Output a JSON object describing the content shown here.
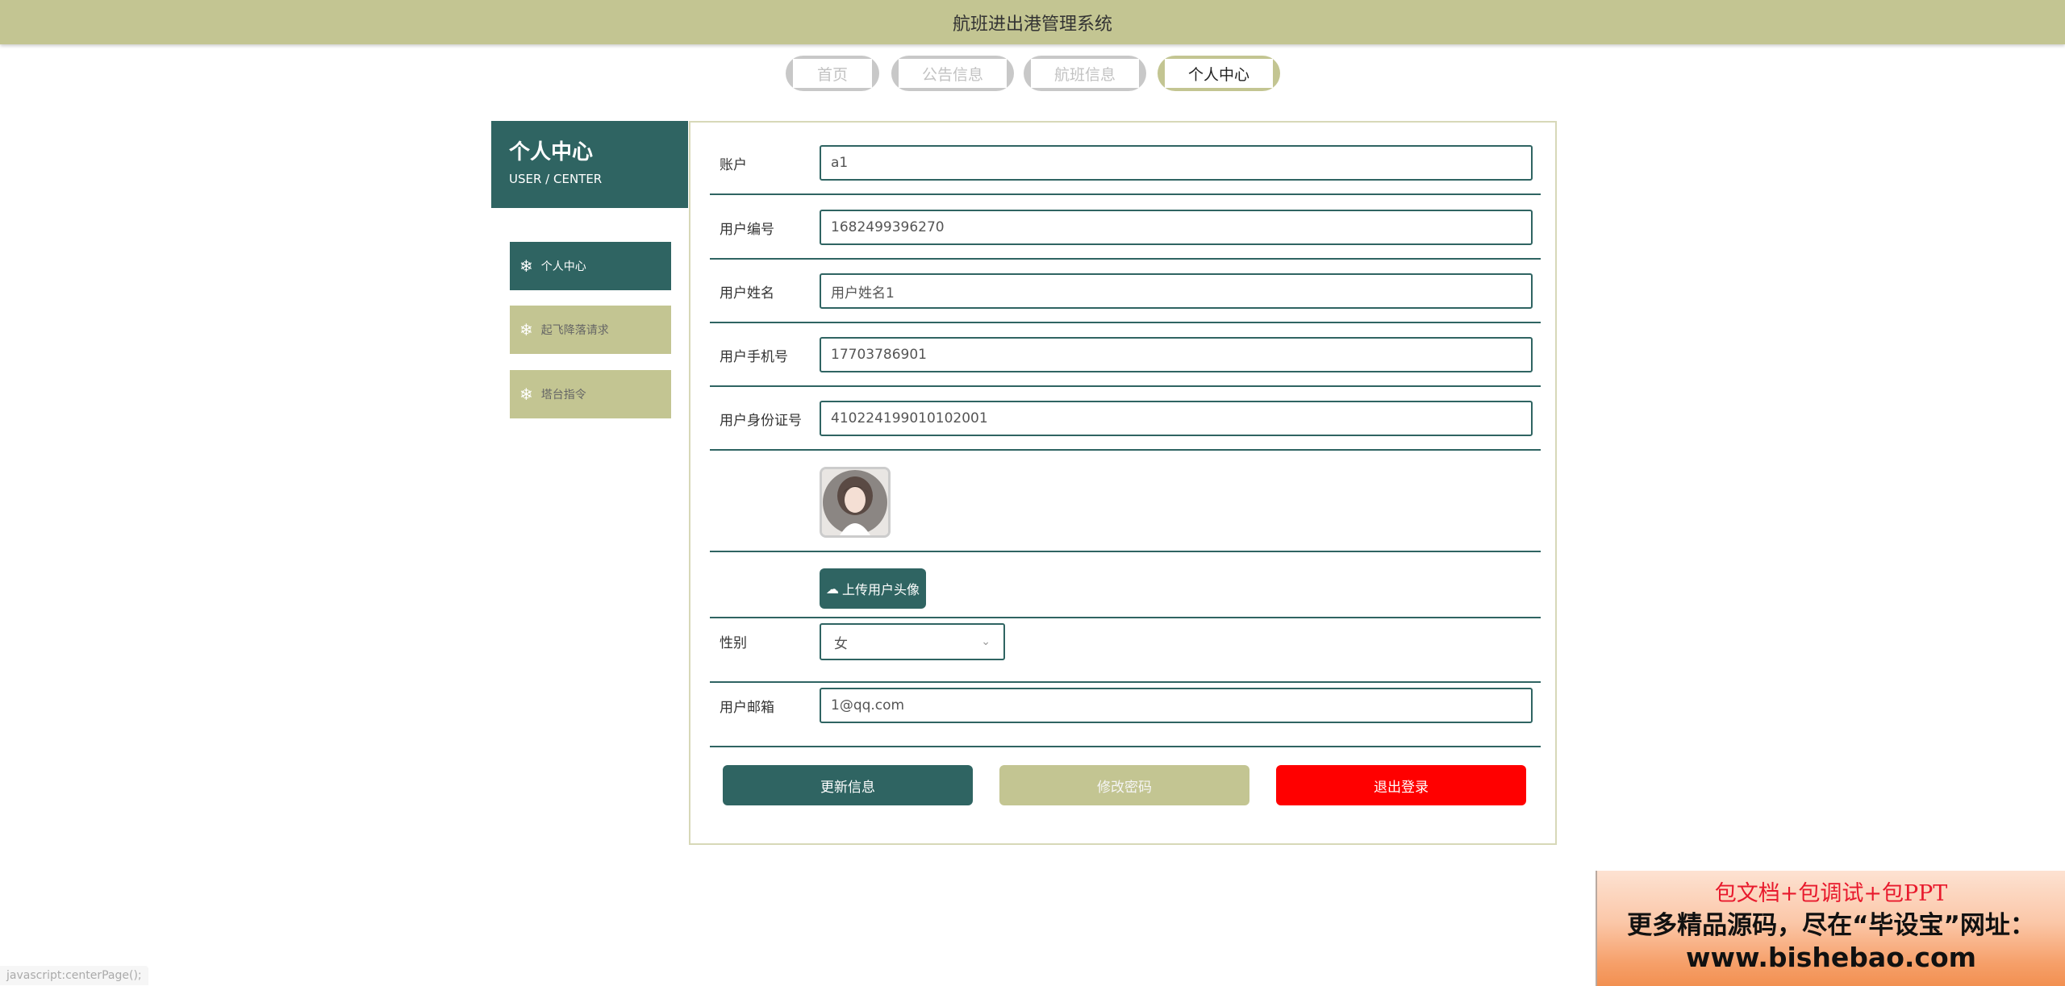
{
  "app": {
    "title": "航班进出港管理系统"
  },
  "nav": {
    "tabs": [
      {
        "label": "首页"
      },
      {
        "label": "公告信息"
      },
      {
        "label": "航班信息"
      },
      {
        "label": "个人中心"
      }
    ],
    "active": "个人中心"
  },
  "sidebar": {
    "title": "个人中心",
    "subtitle": "USER / CENTER",
    "items": [
      {
        "label": "个人中心",
        "icon": "snowflake-icon",
        "active": true
      },
      {
        "label": "起飞降落请求",
        "icon": "snowflake-icon",
        "active": false
      },
      {
        "label": "塔台指令",
        "icon": "snowflake-icon",
        "active": false
      }
    ]
  },
  "form": {
    "account": {
      "label": "账户",
      "value": "a1"
    },
    "user_no": {
      "label": "用户编号",
      "value": "1682499396270"
    },
    "user_name": {
      "label": "用户姓名",
      "value": "用户姓名1"
    },
    "user_phone": {
      "label": "用户手机号",
      "value": "17703786901"
    },
    "user_id_card": {
      "label": "用户身份证号",
      "value": "410224199010102001"
    },
    "upload_label": "上传用户头像",
    "gender": {
      "label": "性别",
      "value": "女"
    },
    "email": {
      "label": "用户邮箱",
      "value": "1@qq.com"
    }
  },
  "actions": {
    "update": "更新信息",
    "change_password": "修改密码",
    "logout": "退出登录"
  },
  "promo": {
    "line1": "包文档+包调试+包PPT",
    "line2": "更多精品源码，尽在“毕设宝”网址：",
    "line3": "www.bishebao.com"
  },
  "status_bar": {
    "text": "javascript:centerPage();"
  },
  "colors": {
    "accent_dark": "#2f6462",
    "accent_light": "#c3c592",
    "danger": "#ff0000"
  }
}
